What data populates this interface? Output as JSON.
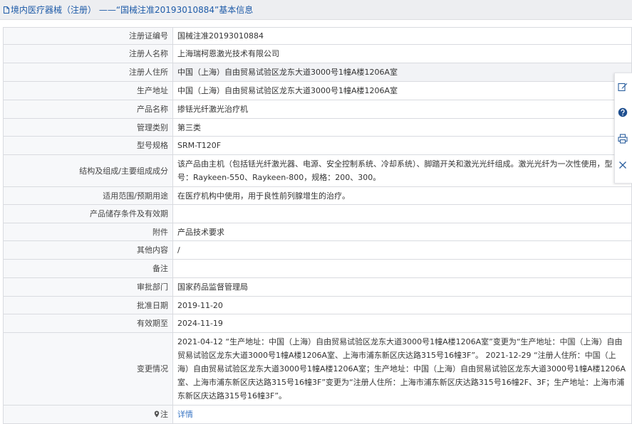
{
  "header": {
    "title": "境内医疗器械（注册） ——“国械注准20193010884”基本信息"
  },
  "rows": [
    {
      "label": "注册证编号",
      "value": "国械注准20193010884"
    },
    {
      "label": "注册人名称",
      "value": "上海瑞柯恩激光技术有限公司"
    },
    {
      "label": "注册人住所",
      "value": "中国（上海）自由贸易试验区龙东大道3000号1幢A楼1206A室"
    },
    {
      "label": "生产地址",
      "value": "中国（上海）自由贸易试验区龙东大道3000号1幢A楼1206A室"
    },
    {
      "label": "产品名称",
      "value": "掺铥光纤激光治疗机"
    },
    {
      "label": "管理类别",
      "value": "第三类"
    },
    {
      "label": "型号规格",
      "value": "SRM-T120F"
    },
    {
      "label": "结构及组成/主要组成成分",
      "value": "该产品由主机（包括铥光纤激光器、电源、安全控制系统、冷却系统）、脚踏开关和激光光纤组成。激光光纤为一次性使用，型号：Raykeen-550、Raykeen-800，规格：200、300。"
    },
    {
      "label": "适用范围/预期用途",
      "value": "在医疗机构中使用，用于良性前列腺增生的治疗。"
    },
    {
      "label": "产品储存条件及有效期",
      "value": ""
    },
    {
      "label": "附件",
      "value": "产品技术要求"
    },
    {
      "label": "其他内容",
      "value": "/"
    },
    {
      "label": "备注",
      "value": ""
    },
    {
      "label": "审批部门",
      "value": "国家药品监督管理局"
    },
    {
      "label": "批准日期",
      "value": "2019-11-20"
    },
    {
      "label": "有效期至",
      "value": "2024-11-19"
    },
    {
      "label": "变更情况",
      "value": "2021-04-12 “生产地址：中国（上海）自由贸易试验区龙东大道3000号1幢A楼1206A室”变更为“生产地址：中国（上海）自由贸易试验区龙东大道3000号1幢A楼1206A室、上海市浦东新区庆达路315号16幢3F”。 2021-12-29 “注册人住所：中国（上海）自由贸易试验区龙东大道3000号1幢A楼1206A室；生产地址：中国（上海）自由贸易试验区龙东大道3000号1幢A楼1206A室、上海市浦东新区庆达路315号16幢3F”变更为“注册人住所：上海市浦东新区庆达路315号16幢2F、3F；生产地址：上海市浦东新区庆达路315号16幢3F”。"
    }
  ],
  "note": {
    "label": "注",
    "link_text": "详情"
  },
  "colors": {
    "link": "#1e5ba8",
    "border": "#d9dbe0",
    "label_bg": "#f7f8fa",
    "alt_bg": "#f2f3f6",
    "titlebar_bg": "#edeef1"
  },
  "side_toolbar": {
    "icons": [
      "edit-icon",
      "help-icon",
      "print-icon",
      "close-icon"
    ]
  }
}
